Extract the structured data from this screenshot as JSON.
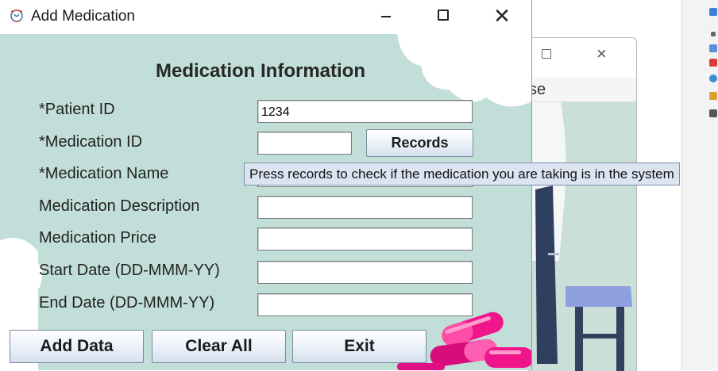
{
  "window": {
    "title": "Add Medication",
    "controls": {
      "minimize_icon": "minimize-icon",
      "maximize_icon": "maximize-icon",
      "close_icon": "close-icon"
    }
  },
  "form": {
    "heading": "Medication Information",
    "fields": [
      {
        "label": "*Patient ID",
        "value": "1234"
      },
      {
        "label": "*Medication ID",
        "value": ""
      },
      {
        "label": "*Medication Name",
        "value": ""
      },
      {
        "label": "Medication Description",
        "value": ""
      },
      {
        "label": "Medication Price",
        "value": ""
      },
      {
        "label": "Start Date (DD-MMM-YY)",
        "value": ""
      },
      {
        "label": "End Date (DD-MMM-YY)",
        "value": ""
      }
    ],
    "records_button": "Records",
    "tooltip": "Press records to check if the medication you are taking is in the system"
  },
  "buttons": {
    "add": "Add Data",
    "clear": "Clear All",
    "exit": "Exit"
  },
  "background_window": {
    "partial_menu_text": "se"
  },
  "colors": {
    "panel_background": "#c1dfd8",
    "cloud": "#ffffff",
    "pill_pink": "#f0158a",
    "tooltip_background": "#dce4f2"
  }
}
